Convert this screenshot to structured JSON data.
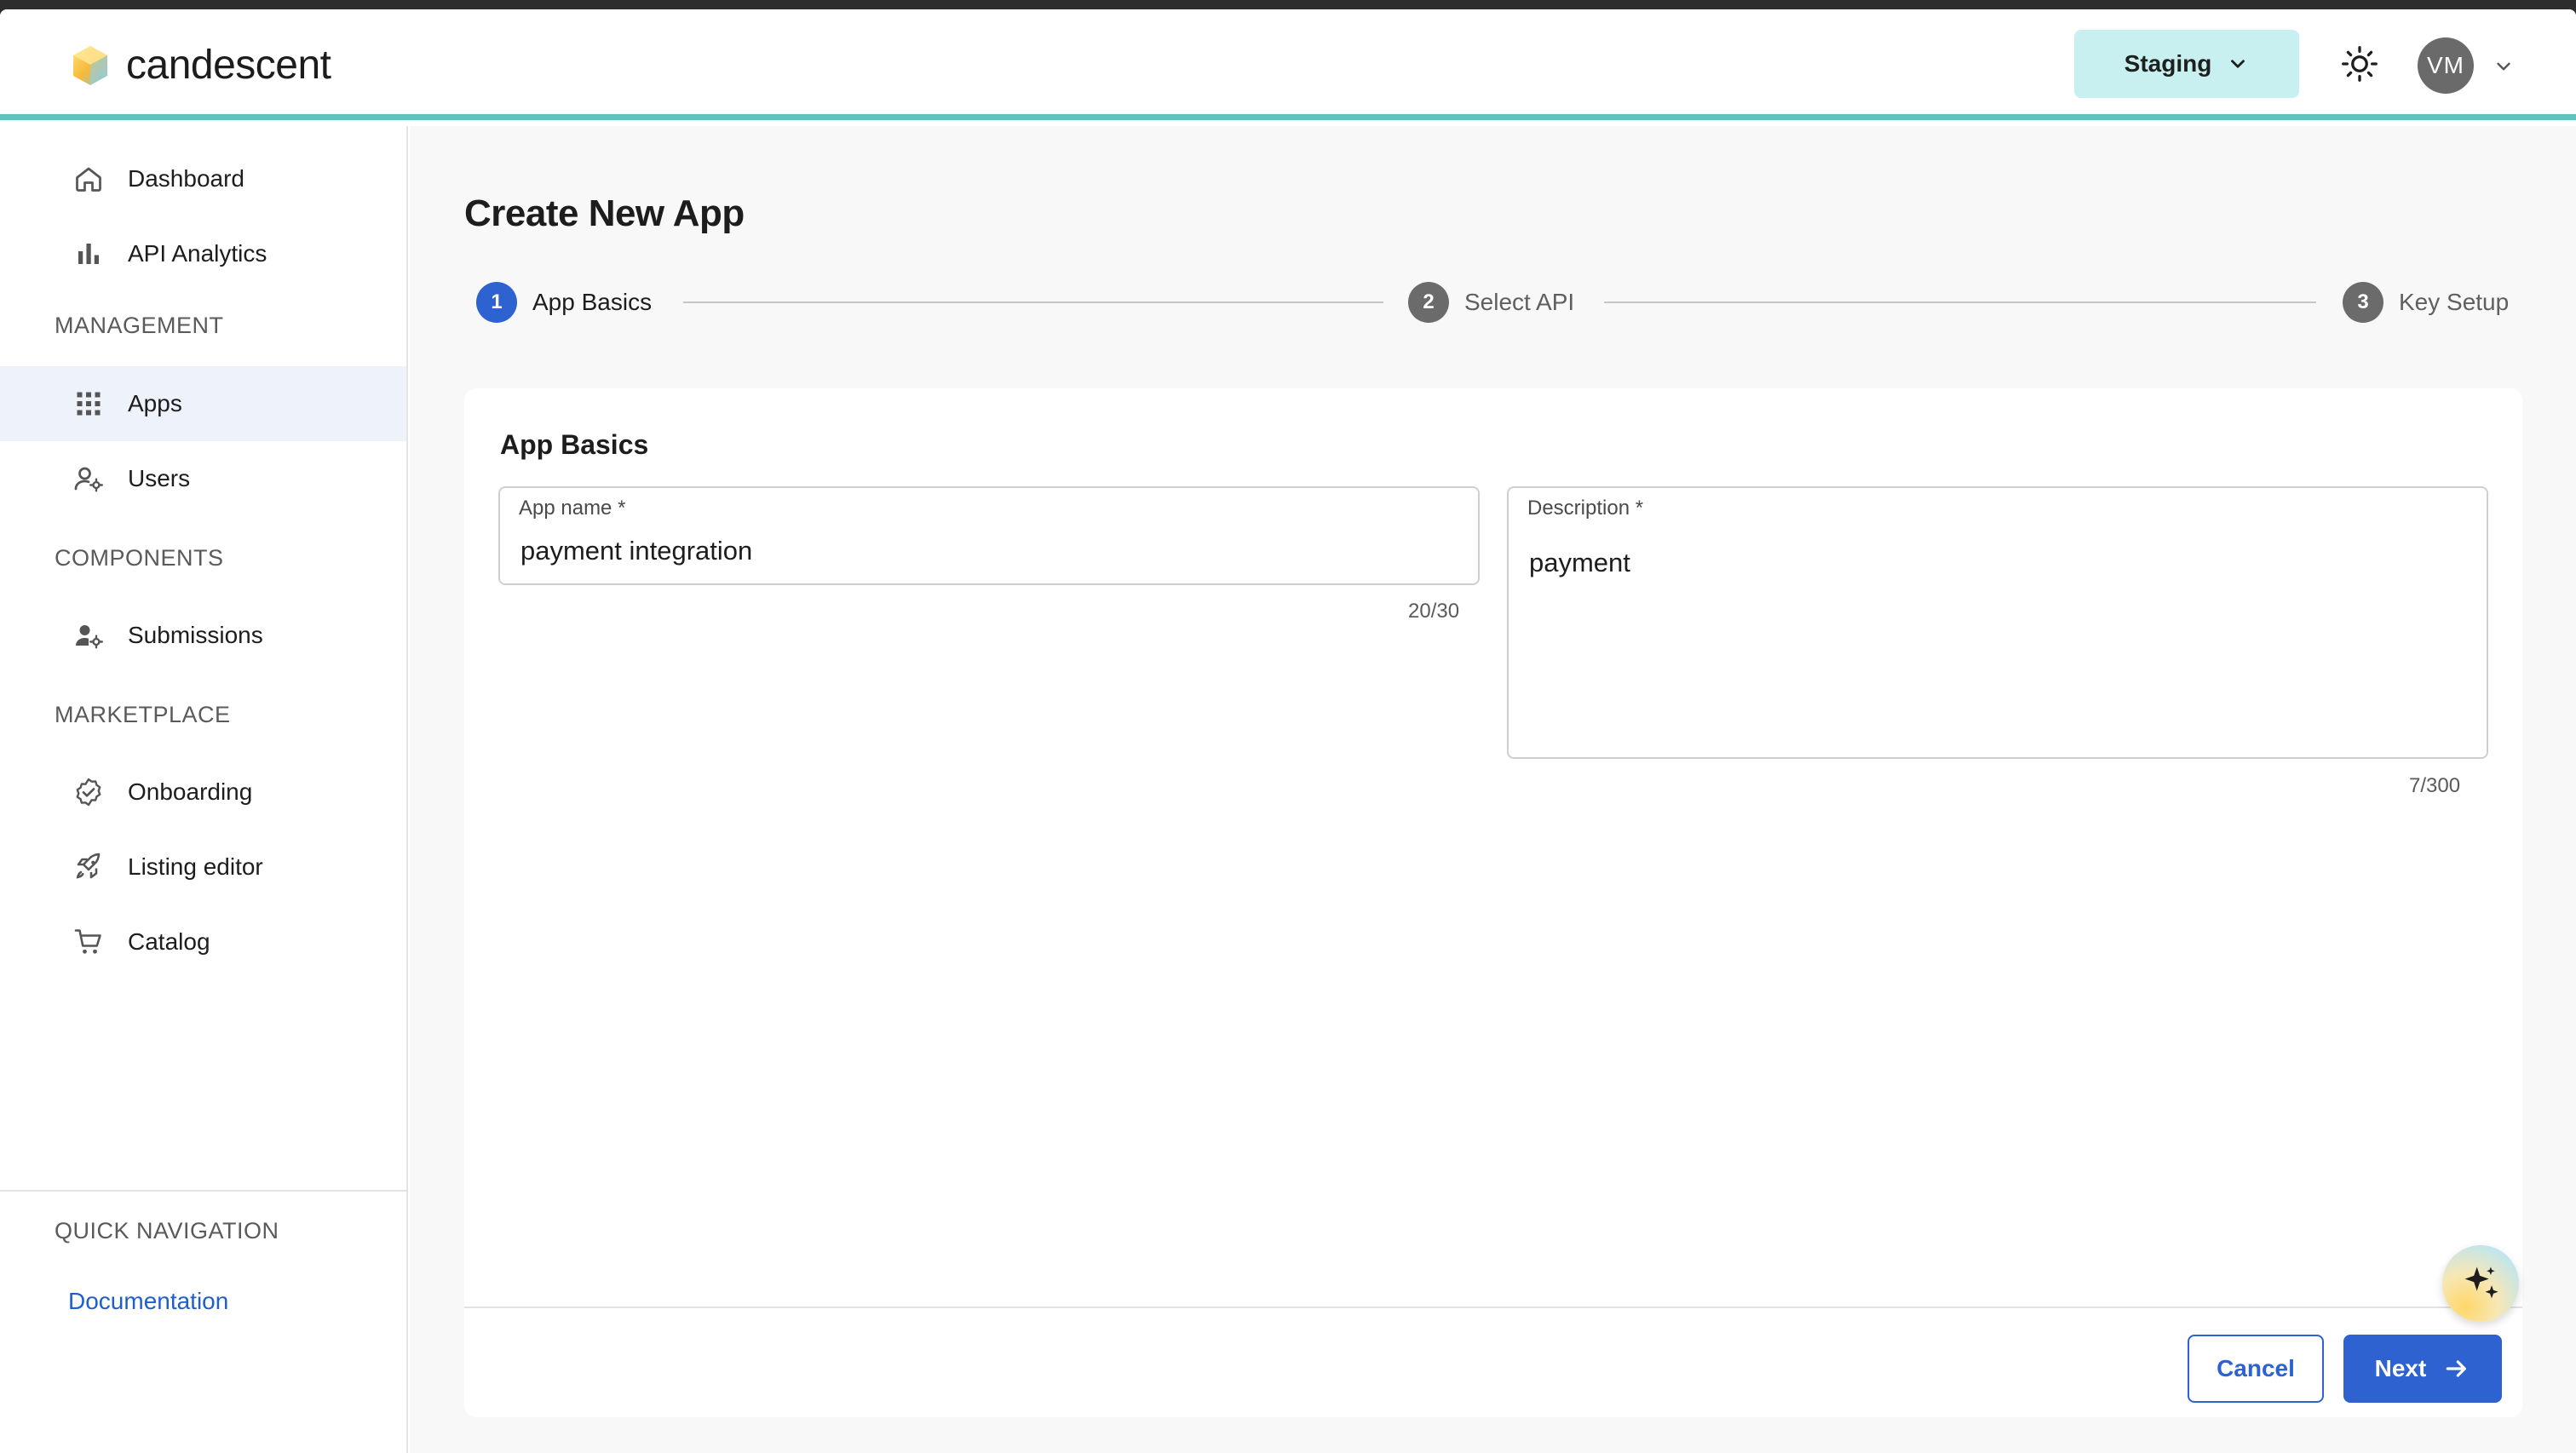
{
  "header": {
    "brand": "candescent",
    "environment": "Staging",
    "avatar_initials": "VM",
    "icons": {
      "theme": "sun-icon",
      "env_chevron": "chevron-down-icon",
      "account_chevron": "chevron-down-icon"
    }
  },
  "sidebar": {
    "top_items": [
      {
        "label": "Dashboard",
        "icon": "home-icon"
      },
      {
        "label": "API Analytics",
        "icon": "bar-chart-icon"
      }
    ],
    "sections": [
      {
        "title": "MANAGEMENT",
        "items": [
          {
            "label": "Apps",
            "icon": "grid-icon",
            "active": true
          },
          {
            "label": "Users",
            "icon": "user-gear-icon"
          }
        ]
      },
      {
        "title": "COMPONENTS",
        "items": [
          {
            "label": "Submissions",
            "icon": "user-gear-filled-icon"
          }
        ]
      },
      {
        "title": "MARKETPLACE",
        "items": [
          {
            "label": "Onboarding",
            "icon": "badge-check-icon"
          },
          {
            "label": "Listing editor",
            "icon": "rocket-icon"
          },
          {
            "label": "Catalog",
            "icon": "cart-icon"
          }
        ]
      }
    ],
    "quick_nav": {
      "title": "QUICK NAVIGATION",
      "link": "Documentation"
    }
  },
  "main": {
    "title": "Create New App",
    "steps": [
      {
        "number": "1",
        "label": "App Basics",
        "state": "current"
      },
      {
        "number": "2",
        "label": "Select API",
        "state": "pending"
      },
      {
        "number": "3",
        "label": "Key Setup",
        "state": "pending"
      }
    ],
    "card": {
      "title": "App Basics",
      "app_name": {
        "label": "App name *",
        "value": "payment integration",
        "counter": "20/30"
      },
      "description": {
        "label": "Description *",
        "value": "payment",
        "counter": "7/300"
      }
    },
    "actions": {
      "cancel": "Cancel",
      "next": "Next"
    }
  },
  "colors": {
    "primary": "#2d62d0",
    "accent_border": "#5fc2c0",
    "env_bg": "#c8f0f0",
    "active_nav_bg": "#eef2fb"
  }
}
